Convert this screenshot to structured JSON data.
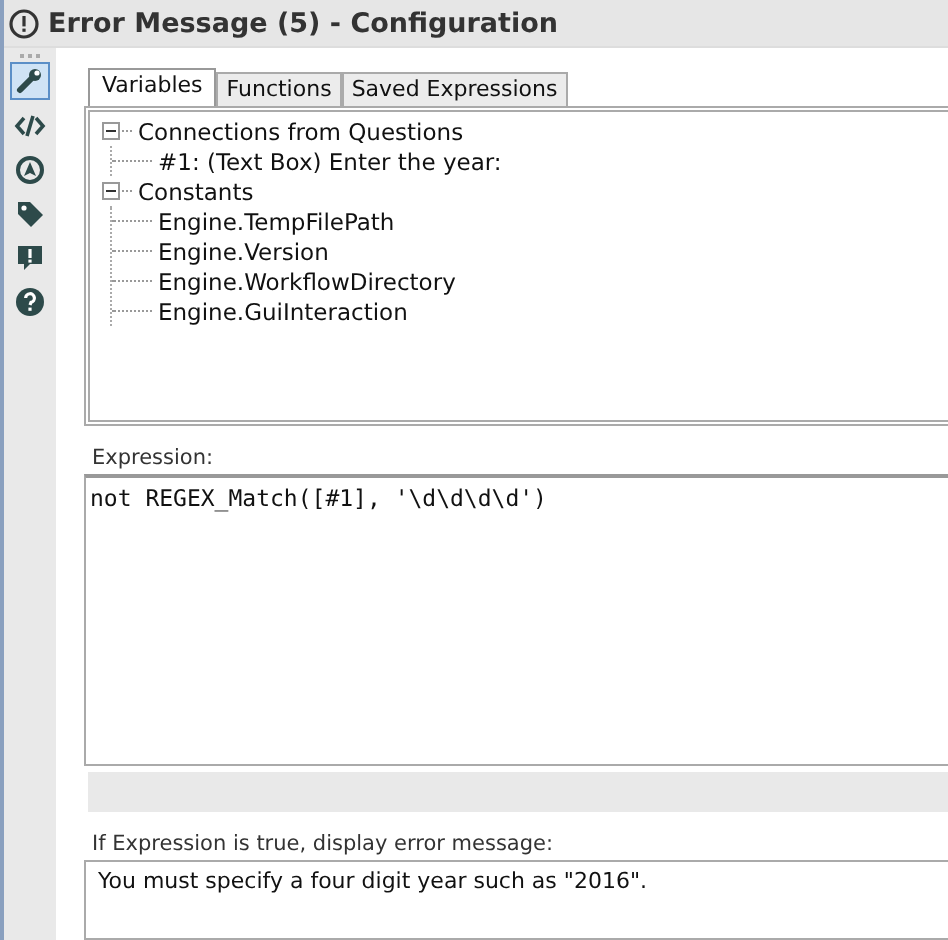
{
  "window": {
    "title": "Error Message (5) - Configuration"
  },
  "sidebar": {
    "items": [
      {
        "kind": "wrench",
        "selected": true
      },
      {
        "kind": "code",
        "selected": false
      },
      {
        "kind": "compass",
        "selected": false
      },
      {
        "kind": "tag",
        "selected": false
      },
      {
        "kind": "alert",
        "selected": false
      },
      {
        "kind": "help",
        "selected": false
      }
    ]
  },
  "tabs": [
    {
      "label": "Variables",
      "selected": true
    },
    {
      "label": "Functions",
      "selected": false
    },
    {
      "label": "Saved Expressions",
      "selected": false
    }
  ],
  "tree": [
    {
      "label": "Connections from Questions",
      "expanded": true,
      "children": [
        {
          "label": "#1: (Text Box) Enter the year:"
        }
      ]
    },
    {
      "label": "Constants",
      "expanded": true,
      "children": [
        {
          "label": "Engine.TempFilePath"
        },
        {
          "label": "Engine.Version"
        },
        {
          "label": "Engine.WorkflowDirectory"
        },
        {
          "label": "Engine.GuiInteraction"
        }
      ]
    }
  ],
  "expression": {
    "label": "Expression:",
    "value": "not REGEX_Match([#1], '\\d\\d\\d\\d')"
  },
  "message": {
    "label": "If Expression is true, display error message:",
    "value": "You must specify a four digit year such as \"2016\"."
  }
}
